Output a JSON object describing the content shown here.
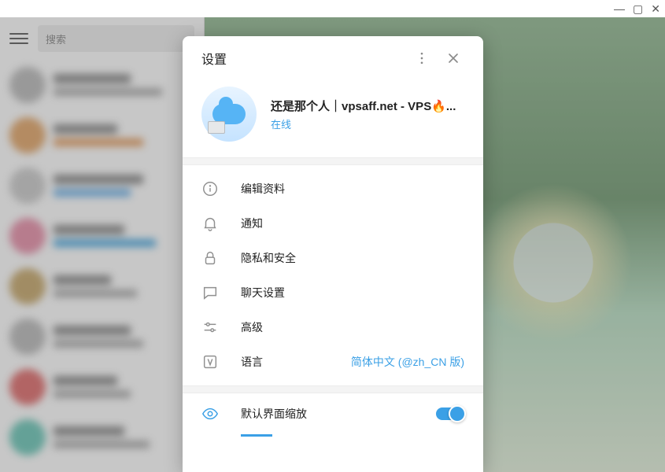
{
  "window": {
    "minimize": "—",
    "maximize": "▢",
    "close": "✕"
  },
  "sidebar": {
    "search_placeholder": "搜索"
  },
  "modal": {
    "title": "设置",
    "profile": {
      "name": "还是那个人｜vpsaff.net - VPS🔥...",
      "status": "在线"
    },
    "menu": {
      "edit_profile": "编辑资料",
      "notifications": "通知",
      "privacy": "隐私和安全",
      "chat_settings": "聊天设置",
      "advanced": "高级",
      "language": "语言",
      "language_value": "简体中文 (@zh_CN 版)"
    },
    "scale": {
      "label": "默认界面缩放",
      "enabled": true
    }
  }
}
